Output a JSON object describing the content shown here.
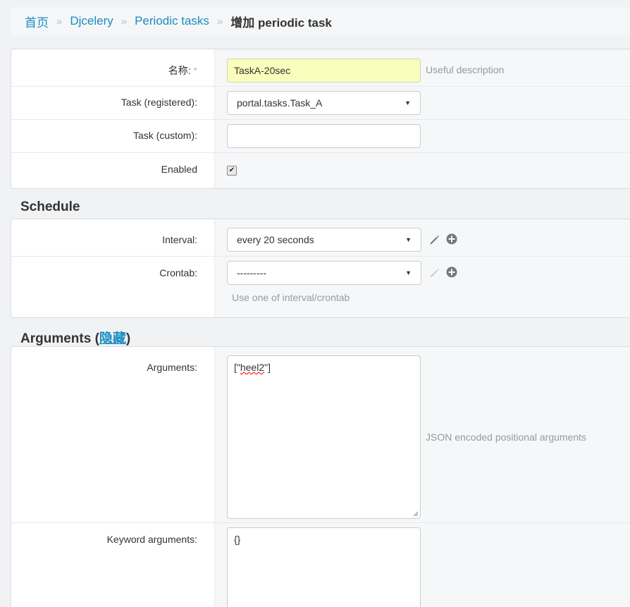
{
  "breadcrumb": {
    "home": "首页",
    "app": "Djcelery",
    "model": "Periodic tasks",
    "current": "增加 periodic task",
    "separator": "»"
  },
  "general": {
    "name_label": "名称:",
    "name_required": "*",
    "name_value": "TaskA-20sec",
    "name_help": "Useful description",
    "task_registered_label": "Task (registered):",
    "task_registered_value": "portal.tasks.Task_A",
    "task_custom_label": "Task (custom):",
    "task_custom_value": "",
    "enabled_label": "Enabled",
    "enabled_checked": true
  },
  "schedule": {
    "title": "Schedule",
    "interval_label": "Interval:",
    "interval_value": "every 20 seconds",
    "crontab_label": "Crontab:",
    "crontab_value": "---------",
    "help": "Use one of interval/crontab"
  },
  "arguments": {
    "title_prefix": "Arguments (",
    "toggle_link": "隐藏",
    "title_suffix": ")",
    "args_label": "Arguments:",
    "args_value_open": "[\"",
    "args_value_word": "heel2",
    "args_value_close": "\"]",
    "args_help": "JSON encoded positional arguments",
    "kwargs_label": "Keyword arguments:",
    "kwargs_value": "{}"
  },
  "icons": {
    "select_arrow": "▼",
    "check": "✔"
  },
  "colors": {
    "link": "#1a8bc4",
    "highlight_input": "#fafdbb"
  }
}
